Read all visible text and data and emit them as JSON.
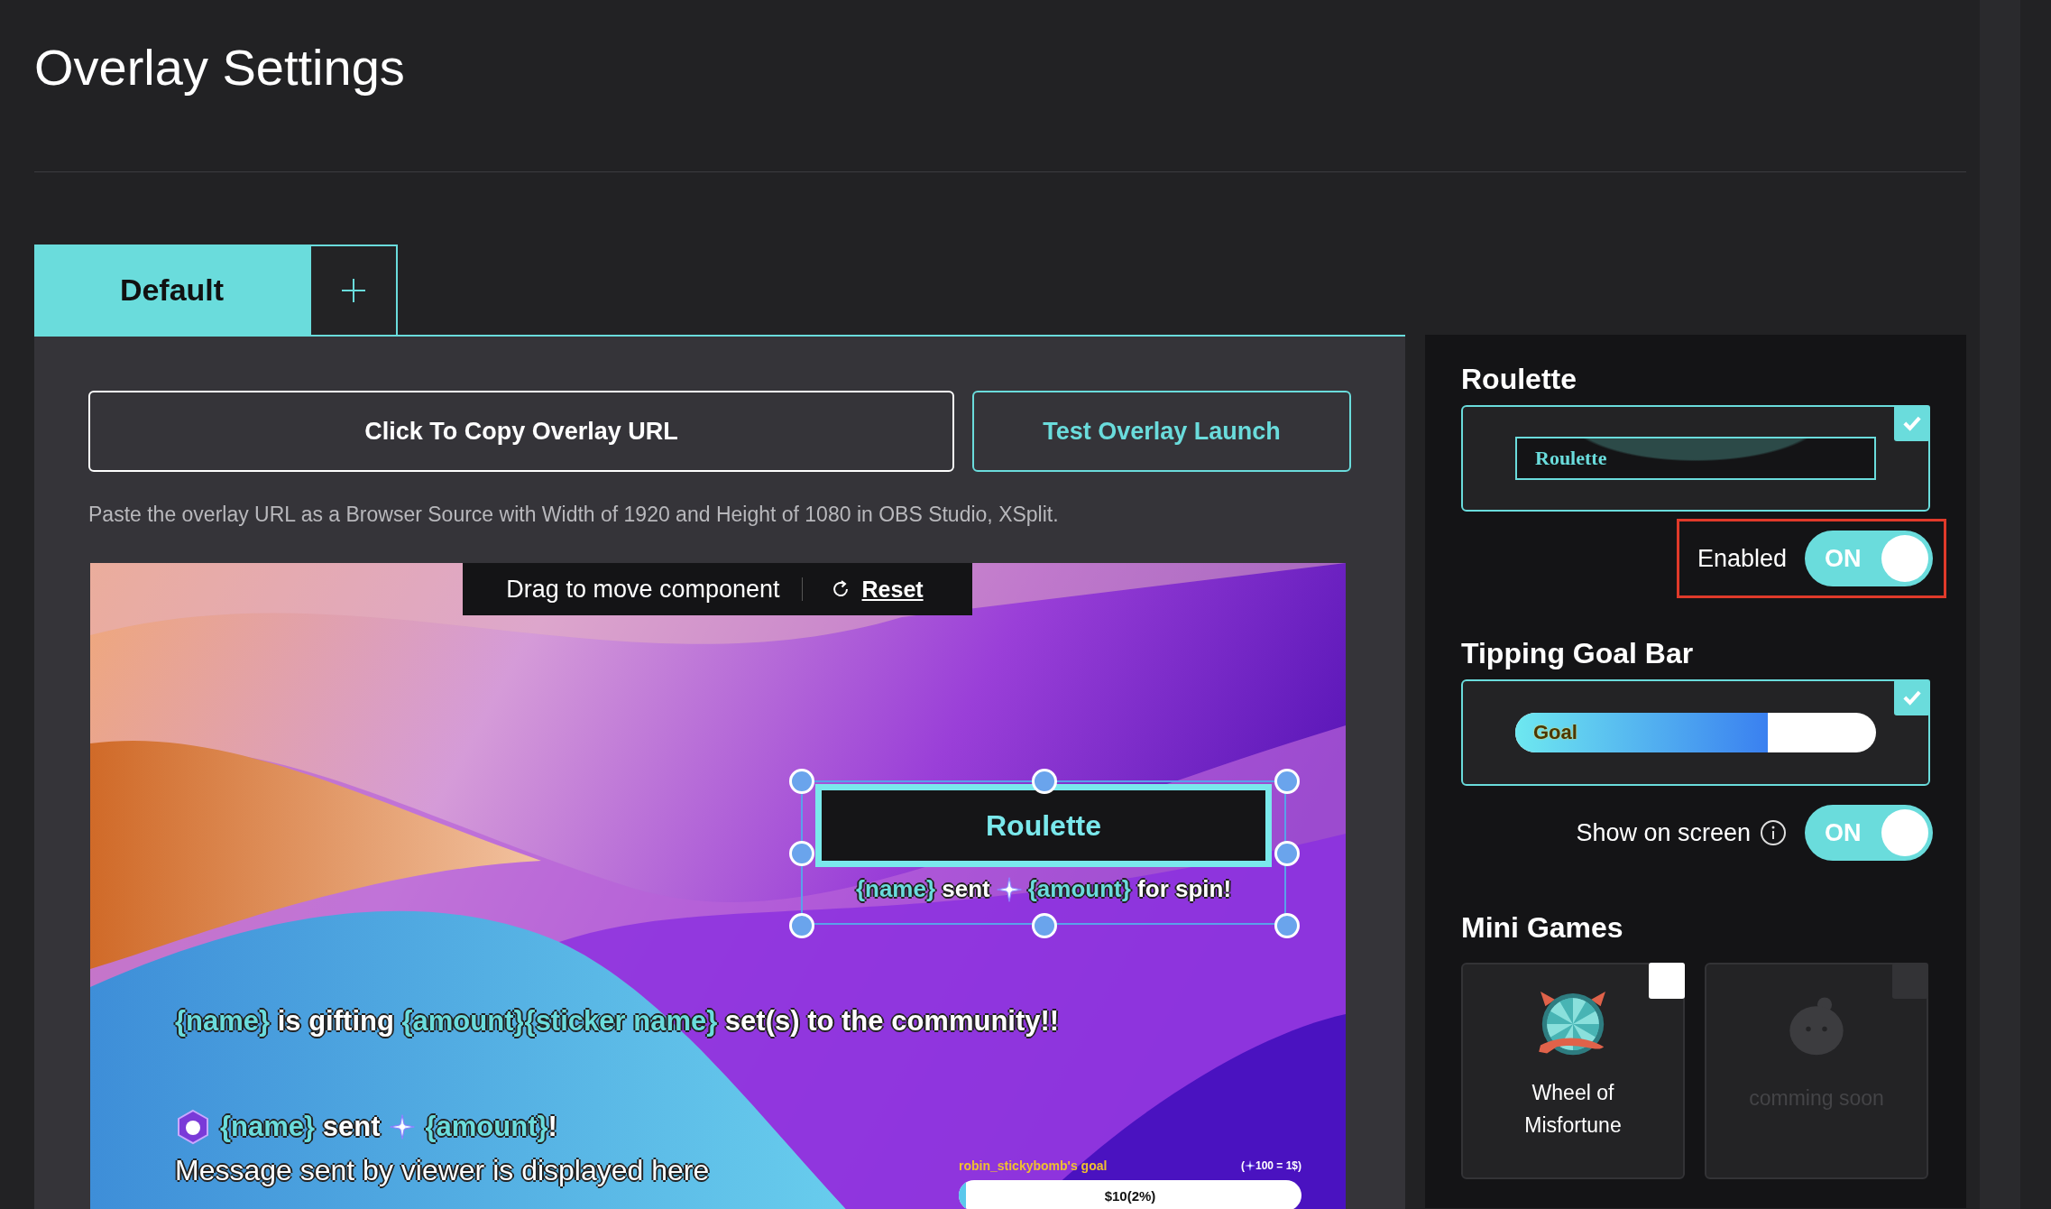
{
  "page": {
    "title": "Overlay Settings"
  },
  "tabs": [
    {
      "label": "Default",
      "selected": true
    }
  ],
  "actions": {
    "copy_button": "Click To Copy Overlay URL",
    "test_button": "Test Overlay Launch",
    "hint": "Paste the overlay URL as a Browser Source with Width of 1920 and Height of 1080 in OBS Studio, XSplit."
  },
  "preview": {
    "drag_hint": "Drag to move component",
    "reset": "Reset",
    "roulette_widget": {
      "title": "Roulette",
      "caption": [
        {
          "kind": "words",
          "segments": [
            {
              "text": "{name}",
              "kind": "variable"
            },
            {
              "text": " sent",
              "kind": "text"
            }
          ]
        },
        {
          "kind": "sparkle"
        },
        {
          "kind": "words",
          "segments": [
            {
              "text": "{amount}",
              "kind": "variable"
            },
            {
              "text": " for spin!",
              "kind": "text"
            }
          ]
        }
      ]
    },
    "gift_message": [
      {
        "text": "{name}",
        "kind": "variable"
      },
      {
        "text": " is gifting ",
        "kind": "text"
      },
      {
        "text": "{amount}",
        "kind": "variable"
      },
      {
        "text": "{sticker name}",
        "kind": "variable"
      },
      {
        "text": " set(s) to the community!!",
        "kind": "text"
      }
    ],
    "sent_message": [
      {
        "kind": "badge"
      },
      {
        "kind": "words",
        "segments": [
          {
            "text": "{name}",
            "kind": "variable"
          },
          {
            "text": " sent",
            "kind": "text"
          }
        ]
      },
      {
        "kind": "sparkle"
      },
      {
        "kind": "words",
        "segments": [
          {
            "text": "{amount}",
            "kind": "variable"
          },
          {
            "text": "!",
            "kind": "text"
          }
        ]
      }
    ],
    "viewer_message": "Message sent by viewer is displayed here",
    "goal_widget": {
      "label": "robin_stickybomb's goal",
      "rate_open": "(",
      "rate": "100 = 1$)",
      "bar_text": "$10(2%)",
      "level": 0.02
    }
  },
  "panel": {
    "roulette": {
      "heading": "Roulette",
      "card_title": "Roulette",
      "checked": true,
      "toggle_label": "Enabled",
      "toggle_text": "ON",
      "on": true,
      "highlighted": true
    },
    "goal_bar": {
      "heading": "Tipping Goal Bar",
      "bar_label": "Goal",
      "level": 0.7,
      "checked": true,
      "toggle_label": "Show on screen",
      "toggle_text": "ON",
      "on": true
    },
    "mini_games": {
      "heading": "Mini Games",
      "items": [
        {
          "label": "Wheel of Misfortune",
          "kind": "wheel",
          "checked": false,
          "disabled": false
        },
        {
          "label": "comming soon",
          "kind": "placeholder",
          "checked": false,
          "disabled": true
        }
      ]
    }
  }
}
